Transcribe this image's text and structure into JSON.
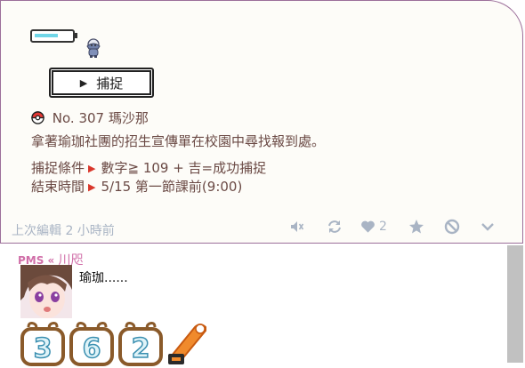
{
  "post": {
    "catch_button": {
      "label": "捕捉",
      "icon": "play-triangle-icon"
    },
    "info": {
      "number": "No. 307",
      "name": "瑪沙那",
      "description": "拿著瑜珈社團的招生宣傳單在校園中尋找報到處。",
      "condition_label": "捕捉條件",
      "condition_value": "數字≧ 109 + 吉=成功捕捉",
      "end_label": "結束時間",
      "end_value": "5/15 第一節課前(9:00)"
    },
    "footer": {
      "last_edited": "上次編輯 2 小時前",
      "like_count": "2",
      "icons": [
        "mute-icon",
        "refresh-icon",
        "heart-icon",
        "star-icon",
        "block-icon",
        "chevron-down-icon"
      ]
    }
  },
  "reply": {
    "author_prefix": "PMS «",
    "author_name": "川咫",
    "text": "瑜珈......",
    "dice": [
      "3",
      "6",
      "2"
    ]
  },
  "colors": {
    "border": "#9c6f9a",
    "text": "#6b4a45",
    "accent_red": "#d9372b",
    "footer_gray": "#a9b4c4",
    "author_pink": "#d06ea8"
  }
}
